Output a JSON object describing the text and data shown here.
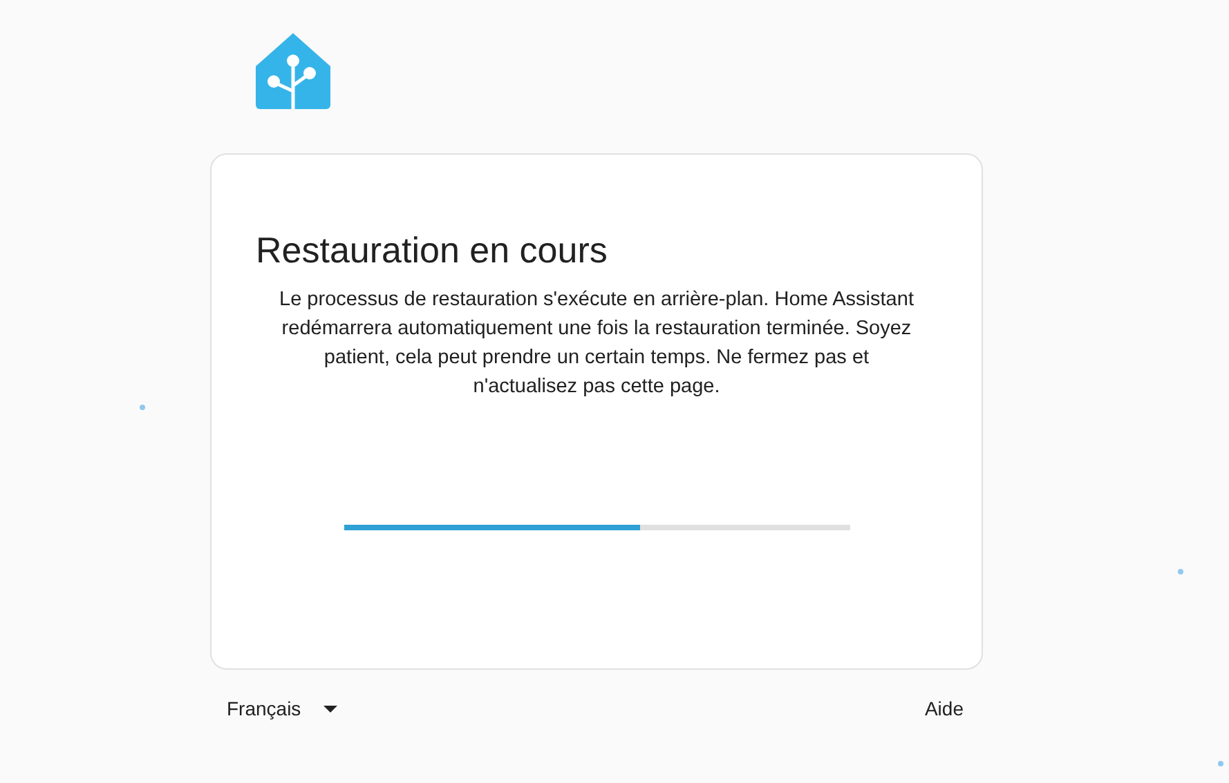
{
  "card": {
    "title": "Restauration en cours",
    "message": "Le processus de restauration s'exécute en arrière-plan. Home Assistant redémarrera automatiquement une fois la restauration terminée. Soyez patient, cela peut prendre un certain temps. Ne fermez pas et n'actualisez pas cette page.",
    "progress": {
      "level": 0.585
    }
  },
  "footer": {
    "language": "Français",
    "help": "Aide"
  }
}
